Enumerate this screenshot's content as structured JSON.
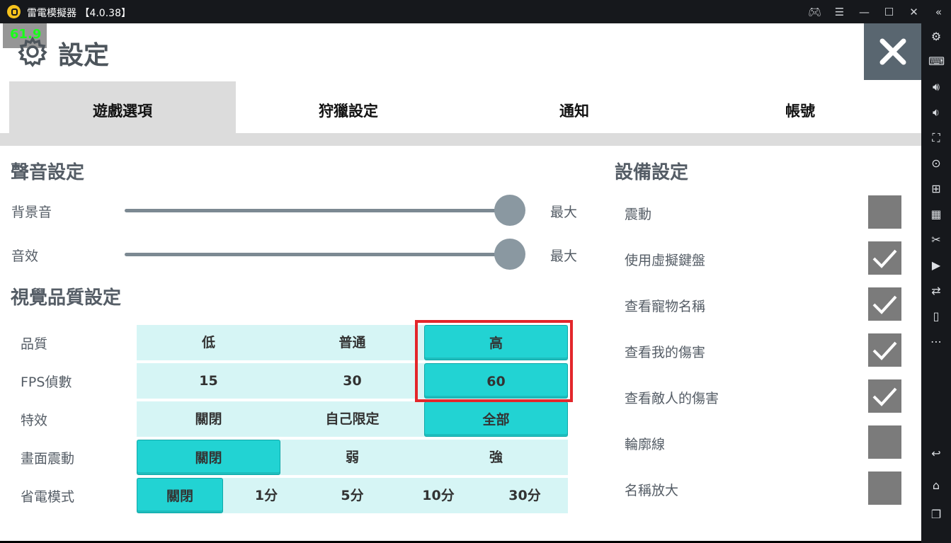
{
  "window": {
    "title": "雷電模擬器 【4.0.38】",
    "controls": [
      "gamepad-icon",
      "menu-icon",
      "minimize-icon",
      "maximize-icon",
      "close-icon",
      "collapse-icon"
    ]
  },
  "overlay": {
    "fps": "61.9"
  },
  "header": {
    "title": "設定"
  },
  "tabs": [
    {
      "label": "遊戲選項",
      "active": true
    },
    {
      "label": "狩獵設定",
      "active": false
    },
    {
      "label": "通知",
      "active": false
    },
    {
      "label": "帳號",
      "active": false
    }
  ],
  "sound": {
    "title": "聲音設定",
    "bgm": {
      "label": "背景音",
      "value": "最大",
      "level": 1.0
    },
    "sfx": {
      "label": "音效",
      "value": "最大",
      "level": 1.0
    }
  },
  "visual": {
    "title": "視覺品質設定",
    "rows": [
      {
        "label": "品質",
        "options": [
          "低",
          "普通",
          "高"
        ],
        "selected": 2
      },
      {
        "label": "FPS偵數",
        "options": [
          "15",
          "30",
          "60"
        ],
        "selected": 2
      },
      {
        "label": "特效",
        "options": [
          "關閉",
          "自己限定",
          "全部"
        ],
        "selected": 2
      },
      {
        "label": "畫面震動",
        "options": [
          "關閉",
          "弱",
          "強"
        ],
        "selected": 0
      },
      {
        "label": "省電模式",
        "options": [
          "關閉",
          "1分",
          "5分",
          "10分",
          "30分"
        ],
        "selected": 0
      }
    ]
  },
  "device": {
    "title": "設備設定",
    "items": [
      {
        "label": "震動",
        "checked": false
      },
      {
        "label": "使用虛擬鍵盤",
        "checked": true
      },
      {
        "label": "查看寵物名稱",
        "checked": true
      },
      {
        "label": "查看我的傷害",
        "checked": true
      },
      {
        "label": "查看敵人的傷害",
        "checked": true
      },
      {
        "label": "輪廓線",
        "checked": false
      },
      {
        "label": "名稱放大",
        "checked": false
      }
    ]
  },
  "sidebar_icons": [
    "settings-icon",
    "keyboard-icon",
    "volume-up-icon",
    "volume-down-icon",
    "screenshot-icon",
    "record-icon",
    "add-window-icon",
    "apk-icon",
    "scissors-icon",
    "video-icon",
    "sync-icon",
    "shake-icon",
    "more-icon",
    "back-icon",
    "home-icon",
    "recent-apps-icon"
  ],
  "colors": {
    "accent": "#22d3d3",
    "highlight": "#e3262b",
    "option_bg": "#d6f5f5"
  }
}
